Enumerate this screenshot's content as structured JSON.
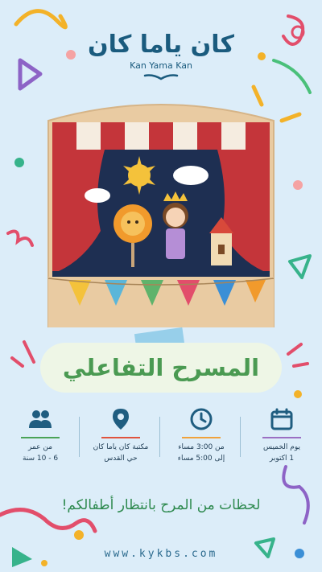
{
  "brand": {
    "name_ar": "كان ياما كان",
    "name_en": "Kan Yama Kan"
  },
  "title": "المسرح التفاعلي",
  "info": [
    {
      "icon": "calendar-icon",
      "color": "#9b6fc3",
      "line1": "يوم الخميس",
      "line2": "1 اكتوبر"
    },
    {
      "icon": "clock-icon",
      "color": "#f0a23c",
      "line1": "من 3:00 مساء",
      "line2": "إلى 5:00 مساء"
    },
    {
      "icon": "location-pin-icon",
      "color": "#e0533d",
      "line1": "مكتبة كان ياما كان",
      "line2": "حي القدس"
    },
    {
      "icon": "people-icon",
      "color": "#4aa357",
      "line1": "من عمر",
      "line2": "6 - 10 سنة"
    }
  ],
  "tagline": "لحظات من المرح بانتظار أطفالكم!",
  "website": "www.kykbs.com",
  "colors": {
    "background": "#dcedf9",
    "brand": "#1a5b7e",
    "title": "#4a9a52",
    "curtain": "#c4353a",
    "wood": "#e9cba2"
  }
}
